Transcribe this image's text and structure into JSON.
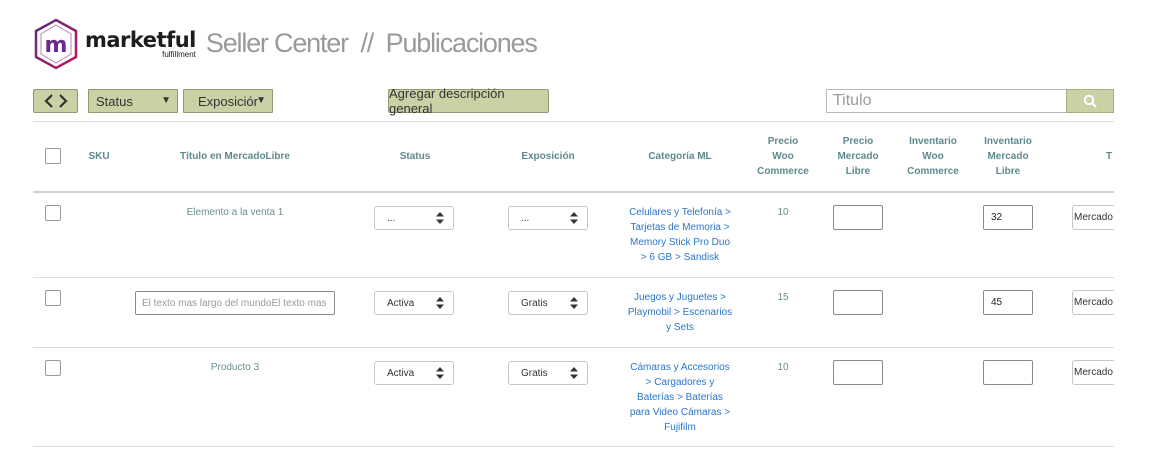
{
  "brand": {
    "name": "marketful",
    "sub": "fulfillment",
    "colors": {
      "purple": "#5b2a86",
      "magenta": "#c2185b"
    }
  },
  "header": {
    "title": "Seller Center  //  Publicaciones"
  },
  "toolbar": {
    "code_icon": "code-brackets-icon",
    "status_label": "Status",
    "exposicion_label": "Exposiciór",
    "add_description_label": "Agregar descripción general",
    "search_placeholder": "Titulo",
    "search_icon": "search-icon",
    "accent_color": "#c8d2a4"
  },
  "table": {
    "headers": {
      "sku": "SKU",
      "titulo": "Título en MercadoLibre",
      "status": "Status",
      "exposicion": "Exposición",
      "categoria": "Categoría ML",
      "precio_woo": [
        "Precio",
        "Woo",
        "Commerce"
      ],
      "precio_ml": [
        "Precio",
        "Mercado",
        "Libre"
      ],
      "inv_woo": [
        "Inventario",
        "Woo",
        "Commerce"
      ],
      "inv_ml": [
        "Inventario",
        "Mercado",
        "Libre"
      ],
      "tienda": "T"
    },
    "rows": [
      {
        "sku": "",
        "titulo": "Elemento a la venta 1",
        "titulo_is_input": false,
        "status": "...",
        "exposicion": "...",
        "categoria": [
          "Celulares y Telefonía >",
          "Tarjetas de Memoria >",
          "Memory Stick Pro Duo",
          "> 6 GB > Sandisk"
        ],
        "precio_woo": "10",
        "precio_ml": "",
        "inv_woo": "",
        "inv_ml": "32",
        "tienda": "Mercado"
      },
      {
        "sku": "",
        "titulo": "El texto mas largo del mundoEl texto mas",
        "titulo_is_input": true,
        "status": "Activa",
        "exposicion": "Gratis",
        "categoria": [
          "Juegos y Juguetes >",
          "Playmobil > Escenarios",
          "y Sets"
        ],
        "precio_woo": "15",
        "precio_ml": "",
        "inv_woo": "",
        "inv_ml": "45",
        "tienda": "Mercado"
      },
      {
        "sku": "",
        "titulo": "Producto 3",
        "titulo_is_input": false,
        "status": "Activa",
        "exposicion": "Gratis",
        "categoria": [
          "Cámaras y Accesorios",
          "> Cargadores y",
          "Baterías > Baterías",
          "para Video Cámaras >",
          "Fujifilm"
        ],
        "precio_woo": "10",
        "precio_ml": "",
        "inv_woo": "",
        "inv_ml": "",
        "tienda": "Mercado"
      }
    ]
  }
}
